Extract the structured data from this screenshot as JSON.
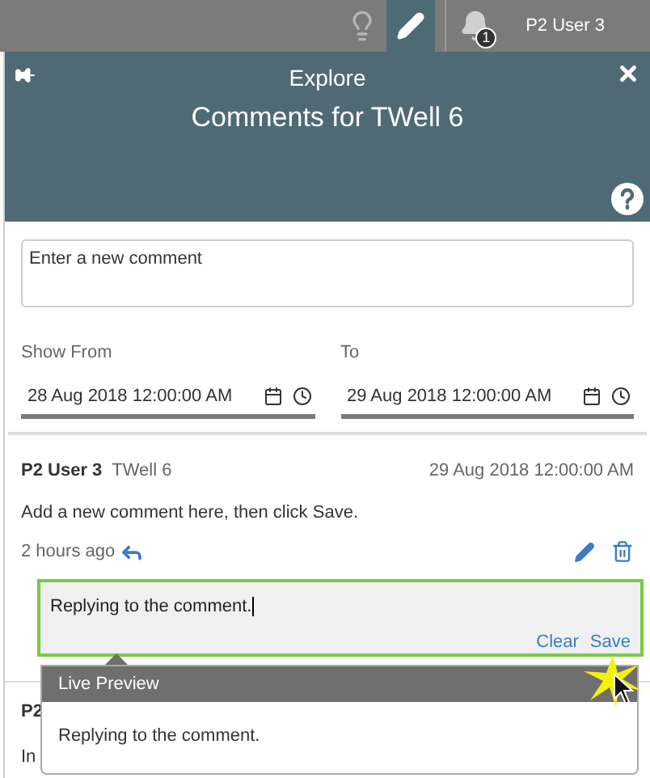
{
  "top_bar": {
    "tools": [
      {
        "kind": "lightbulb",
        "selected": false
      },
      {
        "kind": "pencil",
        "selected": true
      },
      {
        "kind": "bell",
        "selected": false,
        "badge": "1"
      }
    ],
    "user": "P2 User 3"
  },
  "header": {
    "subtitle": "Explore",
    "title": "Comments for TWell 6"
  },
  "new_comment": {
    "placeholder": "Enter a new comment"
  },
  "filters": [
    {
      "label": "Show From",
      "value": "28 Aug 2018 12:00:00 AM"
    },
    {
      "label": "To",
      "value": "29 Aug 2018 12:00:00 AM"
    }
  ],
  "comment": {
    "author": "P2 User 3",
    "well": "TWell 6",
    "date": "29 Aug 2018 12:00:00 AM",
    "text": "Add a new comment here, then click Save.",
    "age": "2 hours ago"
  },
  "reply": {
    "value": "Replying to the comment.",
    "actions": [
      "Clear",
      "Save"
    ]
  },
  "next_comment": {
    "author": "P2",
    "text": "In"
  },
  "preview": {
    "title": "Live Preview",
    "text": "Replying to the comment."
  }
}
